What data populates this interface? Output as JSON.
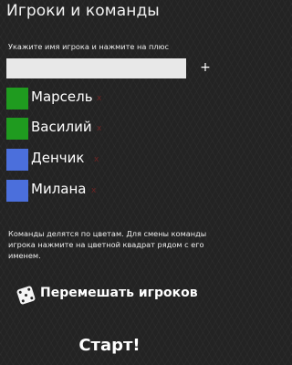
{
  "header": {
    "title": "Игроки и команды"
  },
  "add_player": {
    "prompt": "Укажите имя игрока и нажмите на плюс",
    "input_value": "",
    "add_label": "+"
  },
  "players": [
    {
      "name": "Марсель",
      "color": "#1f9b1f",
      "delete_label": "x"
    },
    {
      "name": "Василий",
      "color": "#1f9b1f",
      "delete_label": "x"
    },
    {
      "name": "Денчик",
      "color": "#4b6fdc",
      "delete_label": "x"
    },
    {
      "name": "Милана",
      "color": "#4b6fdc",
      "delete_label": "x"
    }
  ],
  "hint": "Команды делятся по цветам. Для смены команды игрока нажмите на цветной квадрат рядом с его именем.",
  "shuffle": {
    "label": "Перемешать игроков",
    "icon": "dice-icon"
  },
  "start": {
    "label": "Старт!"
  }
}
